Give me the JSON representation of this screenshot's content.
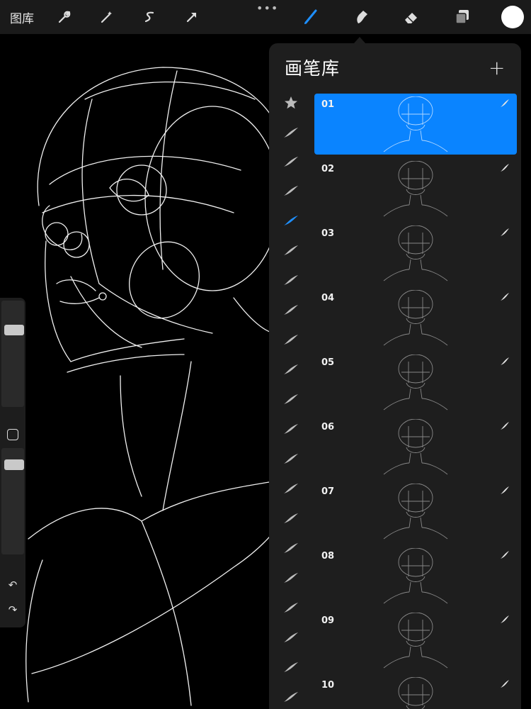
{
  "toolbar": {
    "gallery_label": "图库",
    "more_label": "•••",
    "icons": [
      "wrench-icon",
      "magic-wand-icon",
      "selection-icon",
      "transform-icon",
      "brush-icon",
      "smudge-icon",
      "eraser-icon",
      "layers-icon"
    ],
    "current_color": "#ffffff"
  },
  "panel": {
    "title": "画笔库",
    "add_label": "+",
    "accent": "#0a84ff",
    "brushes": [
      {
        "name": "01",
        "selected": true
      },
      {
        "name": "02",
        "selected": false
      },
      {
        "name": "03",
        "selected": false
      },
      {
        "name": "04",
        "selected": false
      },
      {
        "name": "05",
        "selected": false
      },
      {
        "name": "06",
        "selected": false
      },
      {
        "name": "07",
        "selected": false
      },
      {
        "name": "08",
        "selected": false
      },
      {
        "name": "09",
        "selected": false
      },
      {
        "name": "10",
        "selected": false
      }
    ],
    "category_icons": [
      "star-icon",
      "brush-set-icon"
    ]
  },
  "sidebar": {
    "undo_label": "↶",
    "redo_label": "↷"
  }
}
